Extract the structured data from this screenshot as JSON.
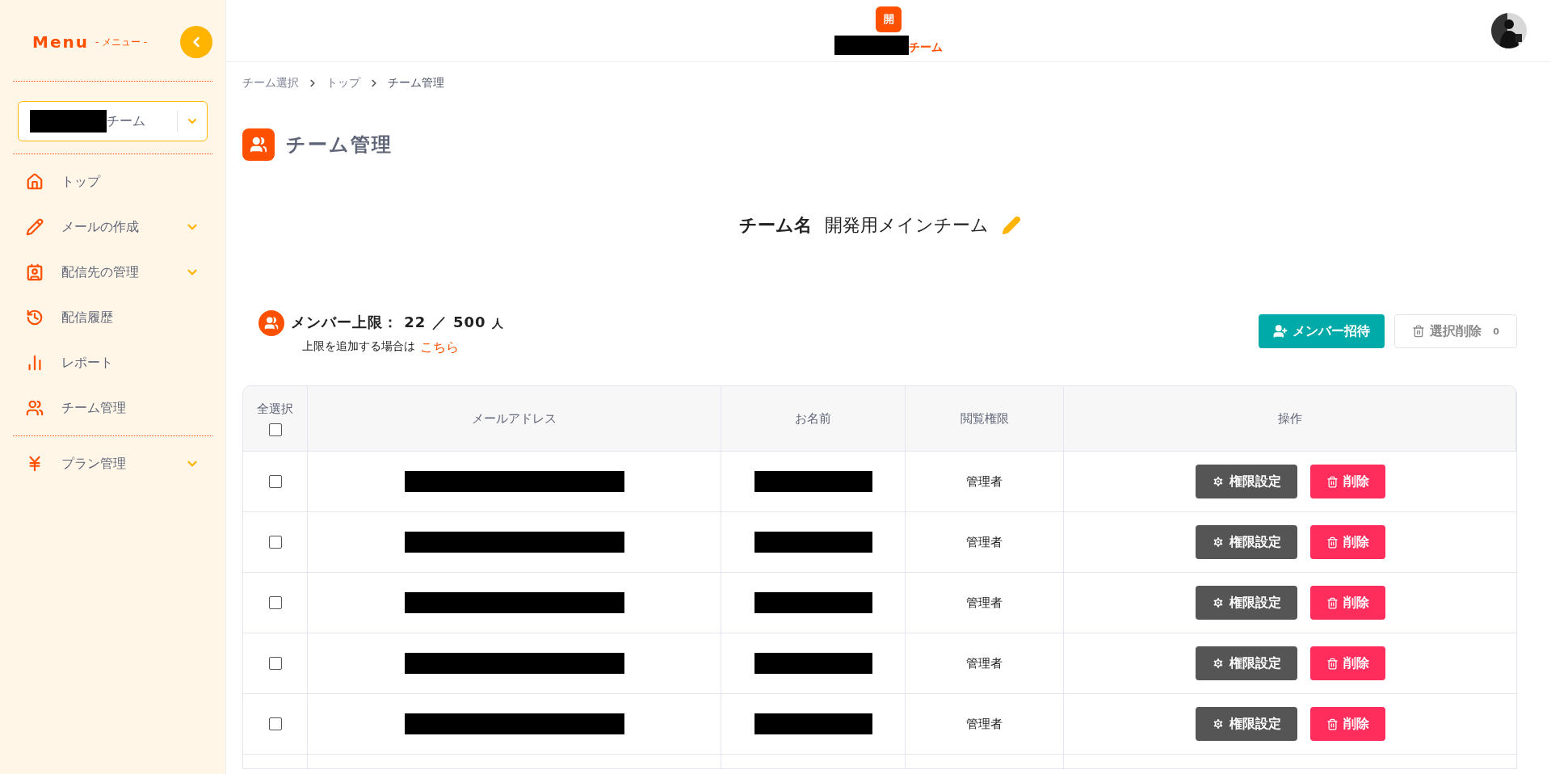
{
  "sidebar": {
    "title": "Menu",
    "subtitle": "- メニュー -",
    "team_select": {
      "redacted": true,
      "value": "チーム"
    },
    "items": [
      {
        "label": "トップ",
        "expandable": false
      },
      {
        "label": "メールの作成",
        "expandable": true
      },
      {
        "label": "配信先の管理",
        "expandable": true
      },
      {
        "label": "配信履歴",
        "expandable": false
      },
      {
        "label": "レポート",
        "expandable": false
      },
      {
        "label": "チーム管理",
        "expandable": false
      }
    ],
    "bottom_items": [
      {
        "label": "プラン管理",
        "expandable": true
      }
    ]
  },
  "header": {
    "badge": "開",
    "team": {
      "redacted": true,
      "suffix": "チーム"
    }
  },
  "breadcrumb": [
    "チーム選択",
    "トップ",
    "チーム管理"
  ],
  "page_title": "チーム管理",
  "team_name": {
    "label": "チーム名",
    "value": "開発用メインチーム"
  },
  "member_limit": {
    "label": "メンバー上限：",
    "current": "22",
    "separator": "／",
    "max": "500",
    "unit": "人",
    "note": "上限を追加する場合は",
    "link": "こちら"
  },
  "actions": {
    "invite": "メンバー招待",
    "bulk_delete": {
      "label": "選択削除",
      "count": "0",
      "disabled": true
    }
  },
  "table": {
    "select_all": {
      "label": "全選択",
      "checked": false
    },
    "columns": [
      "メールアドレス",
      "お名前",
      "閲覧権限",
      "操作"
    ],
    "rows": [
      {
        "checked": false,
        "email_redacted": true,
        "name_redacted": true,
        "role": "管理者",
        "settings": "権限設定",
        "delete": "削除"
      },
      {
        "checked": false,
        "email_redacted": true,
        "name_redacted": true,
        "role": "管理者",
        "settings": "権限設定",
        "delete": "削除"
      },
      {
        "checked": false,
        "email_redacted": true,
        "name_redacted": true,
        "role": "管理者",
        "settings": "権限設定",
        "delete": "削除"
      },
      {
        "checked": false,
        "email_redacted": true,
        "name_redacted": true,
        "role": "管理者",
        "settings": "権限設定",
        "delete": "削除"
      },
      {
        "checked": false,
        "email_redacted": true,
        "name_redacted": true,
        "role": "管理者",
        "settings": "権限設定",
        "delete": "削除"
      }
    ]
  }
}
